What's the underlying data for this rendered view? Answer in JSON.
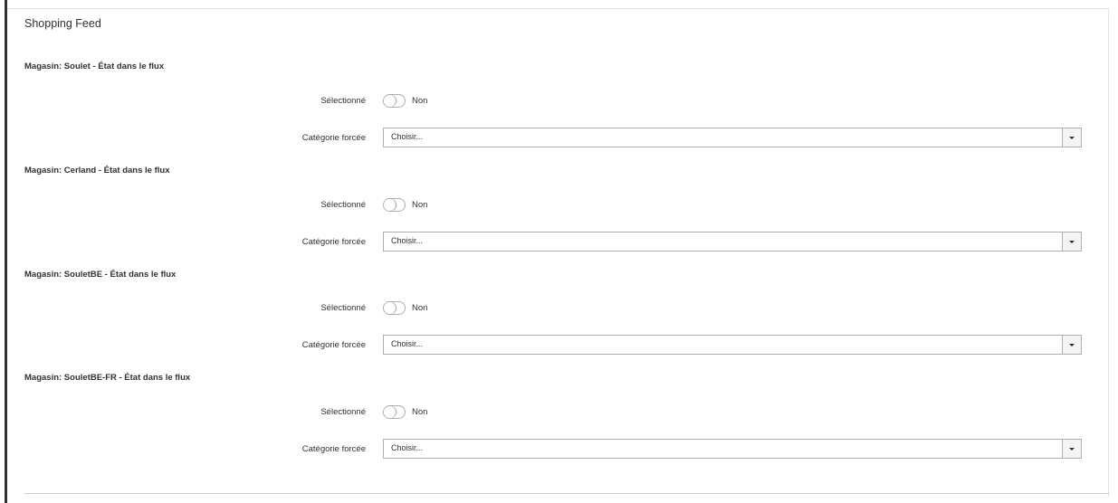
{
  "section": {
    "title": "Shopping Feed"
  },
  "stores": [
    {
      "heading": "Magasin: Soulet - État dans le flux",
      "selected_label": "Sélectionné",
      "selected_value": "Non",
      "category_label": "Catégorie forcée",
      "category_placeholder": "Choisir..."
    },
    {
      "heading": "Magasin: Cerland - État dans le flux",
      "selected_label": "Sélectionné",
      "selected_value": "Non",
      "category_label": "Catégorie forcée",
      "category_placeholder": "Choisir..."
    },
    {
      "heading": "Magasin: SouletBE - État dans le flux",
      "selected_label": "Sélectionné",
      "selected_value": "Non",
      "category_label": "Catégorie forcée",
      "category_placeholder": "Choisir..."
    },
    {
      "heading": "Magasin: SouletBE-FR - État dans le flux",
      "selected_label": "Sélectionné",
      "selected_value": "Non",
      "category_label": "Catégorie forcée",
      "category_placeholder": "Choisir..."
    }
  ],
  "icons": {
    "select_arrow": "chevron-down-icon"
  }
}
